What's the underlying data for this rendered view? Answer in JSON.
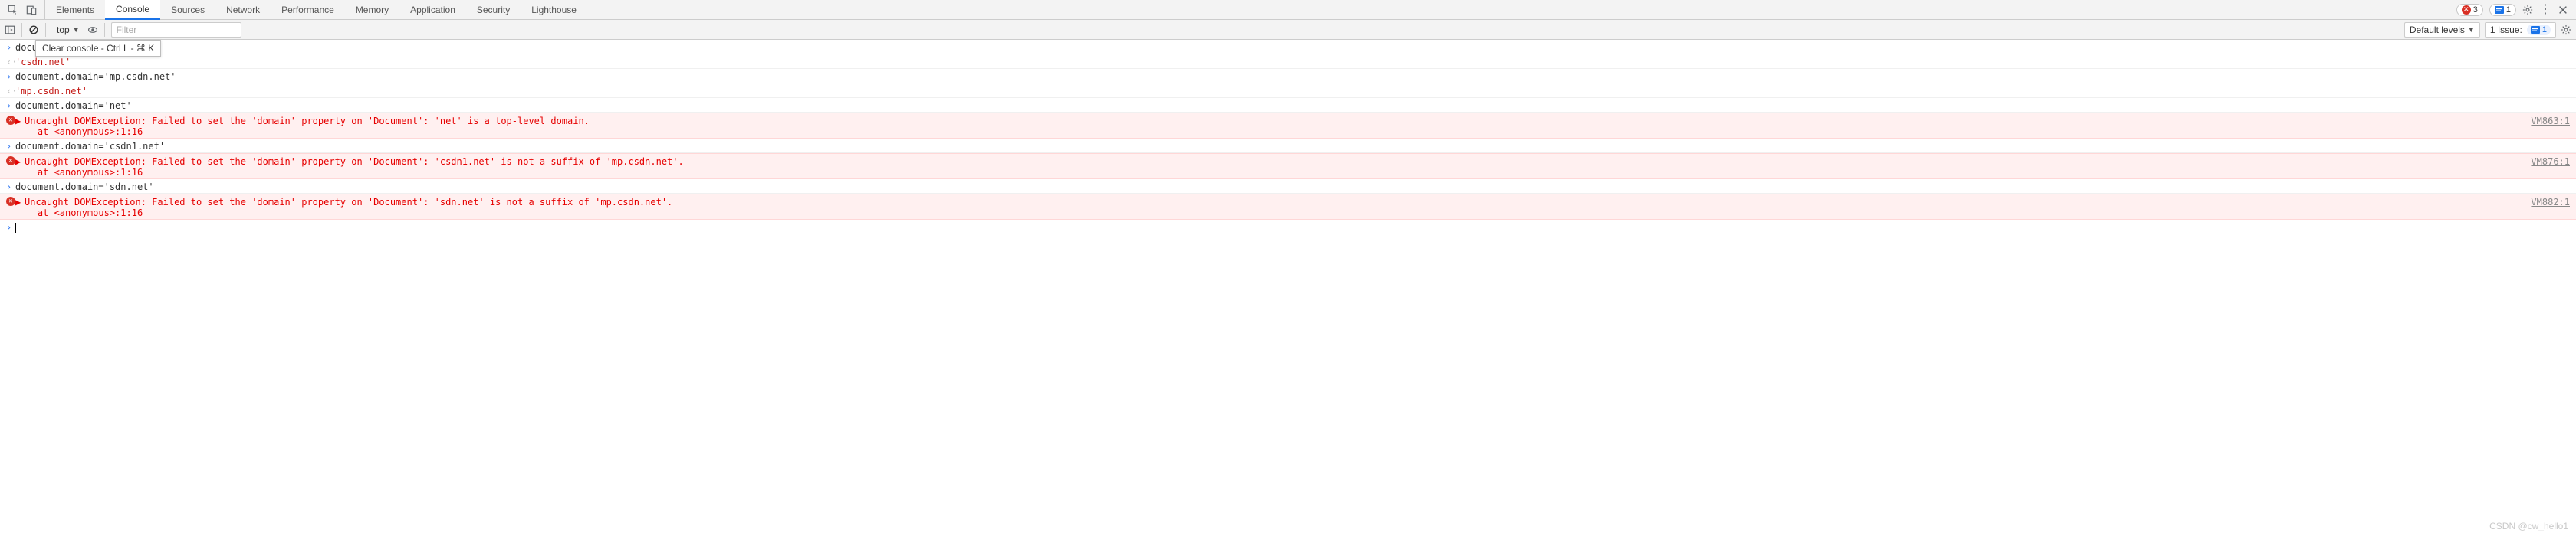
{
  "tabs": {
    "items": [
      "Elements",
      "Console",
      "Sources",
      "Network",
      "Performance",
      "Memory",
      "Application",
      "Security",
      "Lighthouse"
    ],
    "active": "Console"
  },
  "tabstrip_right": {
    "error_count": "3",
    "info_count": "1"
  },
  "toolbar": {
    "context_label": "top",
    "filter_placeholder": "Filter",
    "levels_label": "Default levels",
    "issue_label": "1 Issue:",
    "issue_count": "1",
    "clear_tooltip": "Clear console - Ctrl L - ⌘ K"
  },
  "log": {
    "l0_input": "document.domain='csdn.net'",
    "l0_input_trunc": "docu",
    "l0_result": "'csdn.net'",
    "l1_input": "document.domain='mp.csdn.net'",
    "l1_result": "'mp.csdn.net'",
    "l2_input": "document.domain='net'",
    "l2_error_line1": "Uncaught DOMException: Failed to set the 'domain' property on 'Document': 'net' is a top-level domain.",
    "l2_error_line2": "    at <anonymous>:1:16",
    "l2_error_src": "VM863:1",
    "l3_input": "document.domain='csdn1.net'",
    "l3_error_line1": "Uncaught DOMException: Failed to set the 'domain' property on 'Document': 'csdn1.net' is not a suffix of 'mp.csdn.net'.",
    "l3_error_line2": "    at <anonymous>:1:16",
    "l3_error_src": "VM876:1",
    "l4_input": "document.domain='sdn.net'",
    "l4_error_line1": "Uncaught DOMException: Failed to set the 'domain' property on 'Document': 'sdn.net' is not a suffix of 'mp.csdn.net'.",
    "l4_error_line2": "    at <anonymous>:1:16",
    "l4_error_src": "VM882:1"
  },
  "watermark": "CSDN @cw_hello1"
}
